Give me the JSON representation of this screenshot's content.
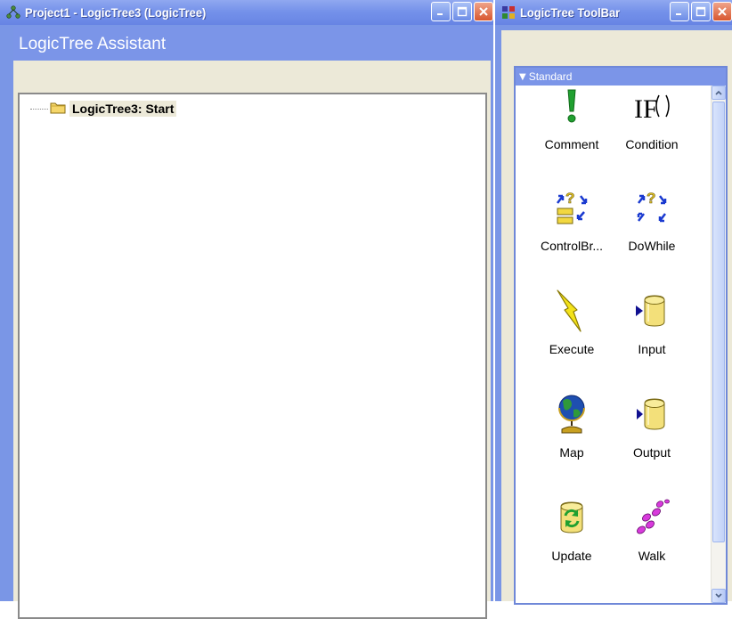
{
  "left_window": {
    "title": "Project1 - LogicTree3 (LogicTree)",
    "title_icon": "project-tree-icon",
    "header": "LogicTree Assistant",
    "tree": [
      {
        "label": "LogicTree3: Start",
        "icon": "folder-icon"
      }
    ],
    "buttons": [
      "minimize",
      "maximize",
      "close"
    ]
  },
  "right_window": {
    "title": "LogicTree ToolBar",
    "title_icon": "toolbar-grid-icon",
    "group": {
      "label": "Standard",
      "expanded": true
    },
    "tools": [
      {
        "label": "Comment",
        "icon": "exclamation-icon"
      },
      {
        "label": "Condition",
        "icon": "if-icon"
      },
      {
        "label": "ControlBr...",
        "icon": "control-break-icon"
      },
      {
        "label": "DoWhile",
        "icon": "do-while-icon"
      },
      {
        "label": "Execute",
        "icon": "lightning-icon"
      },
      {
        "label": "Input",
        "icon": "input-cylinder-icon"
      },
      {
        "label": "Map",
        "icon": "globe-icon"
      },
      {
        "label": "Output",
        "icon": "output-cylinder-icon"
      },
      {
        "label": "Update",
        "icon": "update-cylinder-icon"
      },
      {
        "label": "Walk",
        "icon": "footprints-icon"
      }
    ],
    "buttons": [
      "minimize",
      "maximize",
      "close"
    ]
  },
  "colors": {
    "titlebar": "#7592ea",
    "header": "#7b95e8",
    "face": "#ece9d8",
    "close_button": "#d8572f"
  }
}
